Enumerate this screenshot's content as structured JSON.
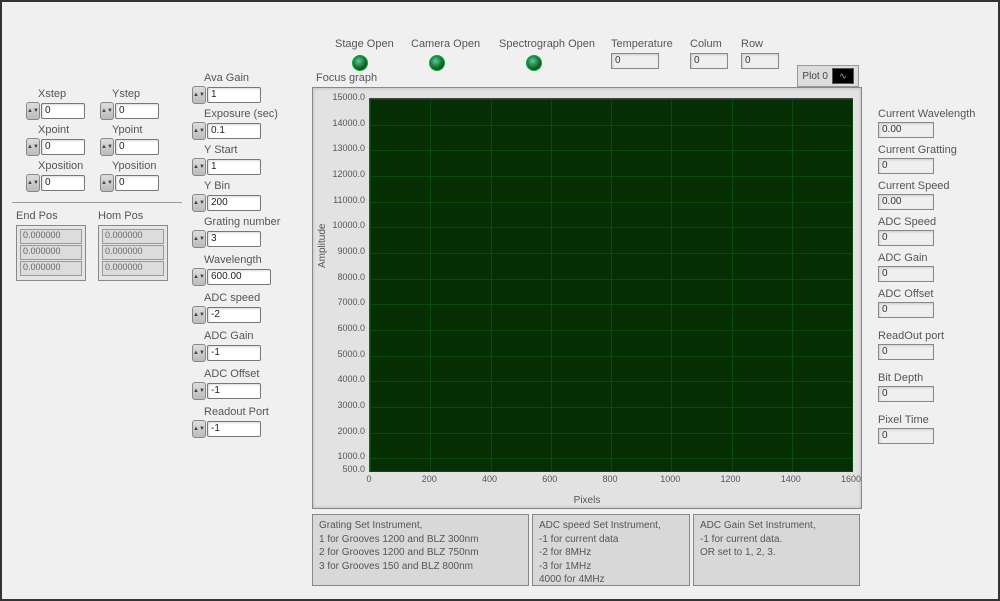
{
  "toprow": {
    "stage_open": "Stage Open",
    "camera_open": "Camera Open",
    "spectro_open": "Spectrograph Open",
    "temperature_lbl": "Temperature",
    "temperature_val": "0",
    "colum_lbl": "Colum",
    "colum_val": "0",
    "row_lbl": "Row",
    "row_val": "0"
  },
  "left": {
    "xstep_lbl": "Xstep",
    "xstep": "0",
    "ystep_lbl": "Ystep",
    "ystep": "0",
    "xpoint_lbl": "Xpoint",
    "xpoint": "0",
    "ypoint_lbl": "Ypoint",
    "ypoint": "0",
    "xpos_lbl": "Xposition",
    "xpos": "0",
    "ypos_lbl": "Yposition",
    "ypos": "0",
    "endpos_lbl": "End Pos",
    "hompos_lbl": "Hom Pos",
    "pos_rows": [
      "0.000000",
      "0.000000",
      "0.000000"
    ]
  },
  "mid": {
    "avagain_lbl": "Ava Gain",
    "avagain": "1",
    "exposure_lbl": "Exposure (sec)",
    "exposure": "0.1",
    "ystart_lbl": "Y Start",
    "ystart": "1",
    "ybin_lbl": "Y Bin",
    "ybin": "200",
    "grating_lbl": "Grating number",
    "grating": "3",
    "wavelength_lbl": "Wavelength",
    "wavelength": "600.00",
    "adcspeed_lbl": "ADC speed",
    "adcspeed": "-2",
    "adcgain_lbl": "ADC Gain",
    "adcgain": "-1",
    "adcoffset_lbl": "ADC Offset",
    "adcoffset": "-1",
    "readout_lbl": "Readout Port",
    "readout": "-1"
  },
  "right": {
    "cur_wl_lbl": "Current Wavelength",
    "cur_wl": "0.00",
    "cur_grat_lbl": "Current Gratting",
    "cur_grat": "0",
    "cur_speed_lbl": "Current Speed",
    "cur_speed": "0.00",
    "adc_speed_lbl": "ADC Speed",
    "adc_speed": "0",
    "adc_gain_lbl": "ADC Gain",
    "adc_gain": "0",
    "adc_offset_lbl": "ADC Offset",
    "adc_offset": "0",
    "readout_lbl": "ReadOut port",
    "readout": "0",
    "bitdepth_lbl": "Bit Depth",
    "bitdepth": "0",
    "pixeltime_lbl": "Pixel Time",
    "pixeltime": "0"
  },
  "chart_data": {
    "type": "line",
    "title": "Focus graph",
    "xlabel": "Pixels",
    "ylabel": "Amplitude",
    "xlim": [
      0,
      1600
    ],
    "ylim": [
      500,
      15000
    ],
    "xticks": [
      0,
      200,
      400,
      600,
      800,
      1000,
      1200,
      1400,
      1600
    ],
    "yticks": [
      500,
      1000,
      2000,
      3000,
      4000,
      5000,
      6000,
      7000,
      8000,
      9000,
      10000,
      11000,
      12000,
      13000,
      14000,
      15000
    ],
    "yticklabels": [
      "500.0",
      "1000.0",
      "2000.0",
      "3000.0",
      "4000.0",
      "5000.0",
      "6000.0",
      "7000.0",
      "8000.0",
      "9000.0",
      "10000.0",
      "11000.0",
      "12000.0",
      "13000.0",
      "14000.0",
      "15000.0"
    ],
    "legend": "Plot 0",
    "series": [
      {
        "name": "Plot 0",
        "x": [],
        "y": []
      }
    ]
  },
  "info": {
    "grating": "Grating Set Instrument,\n1 for Grooves 1200 and BLZ 300nm\n2 for Grooves 1200 and BLZ 750nm\n3 for Grooves 150   and BLZ 800nm",
    "adcspeed": "ADC speed Set Instrument,\n-1 for current data\n-2 for 8MHz\n-3 for 1MHz\n4000 for 4MHz",
    "adcgain": "ADC Gain Set Instrument,\n-1 for current data.\nOR set to 1, 2, 3."
  }
}
